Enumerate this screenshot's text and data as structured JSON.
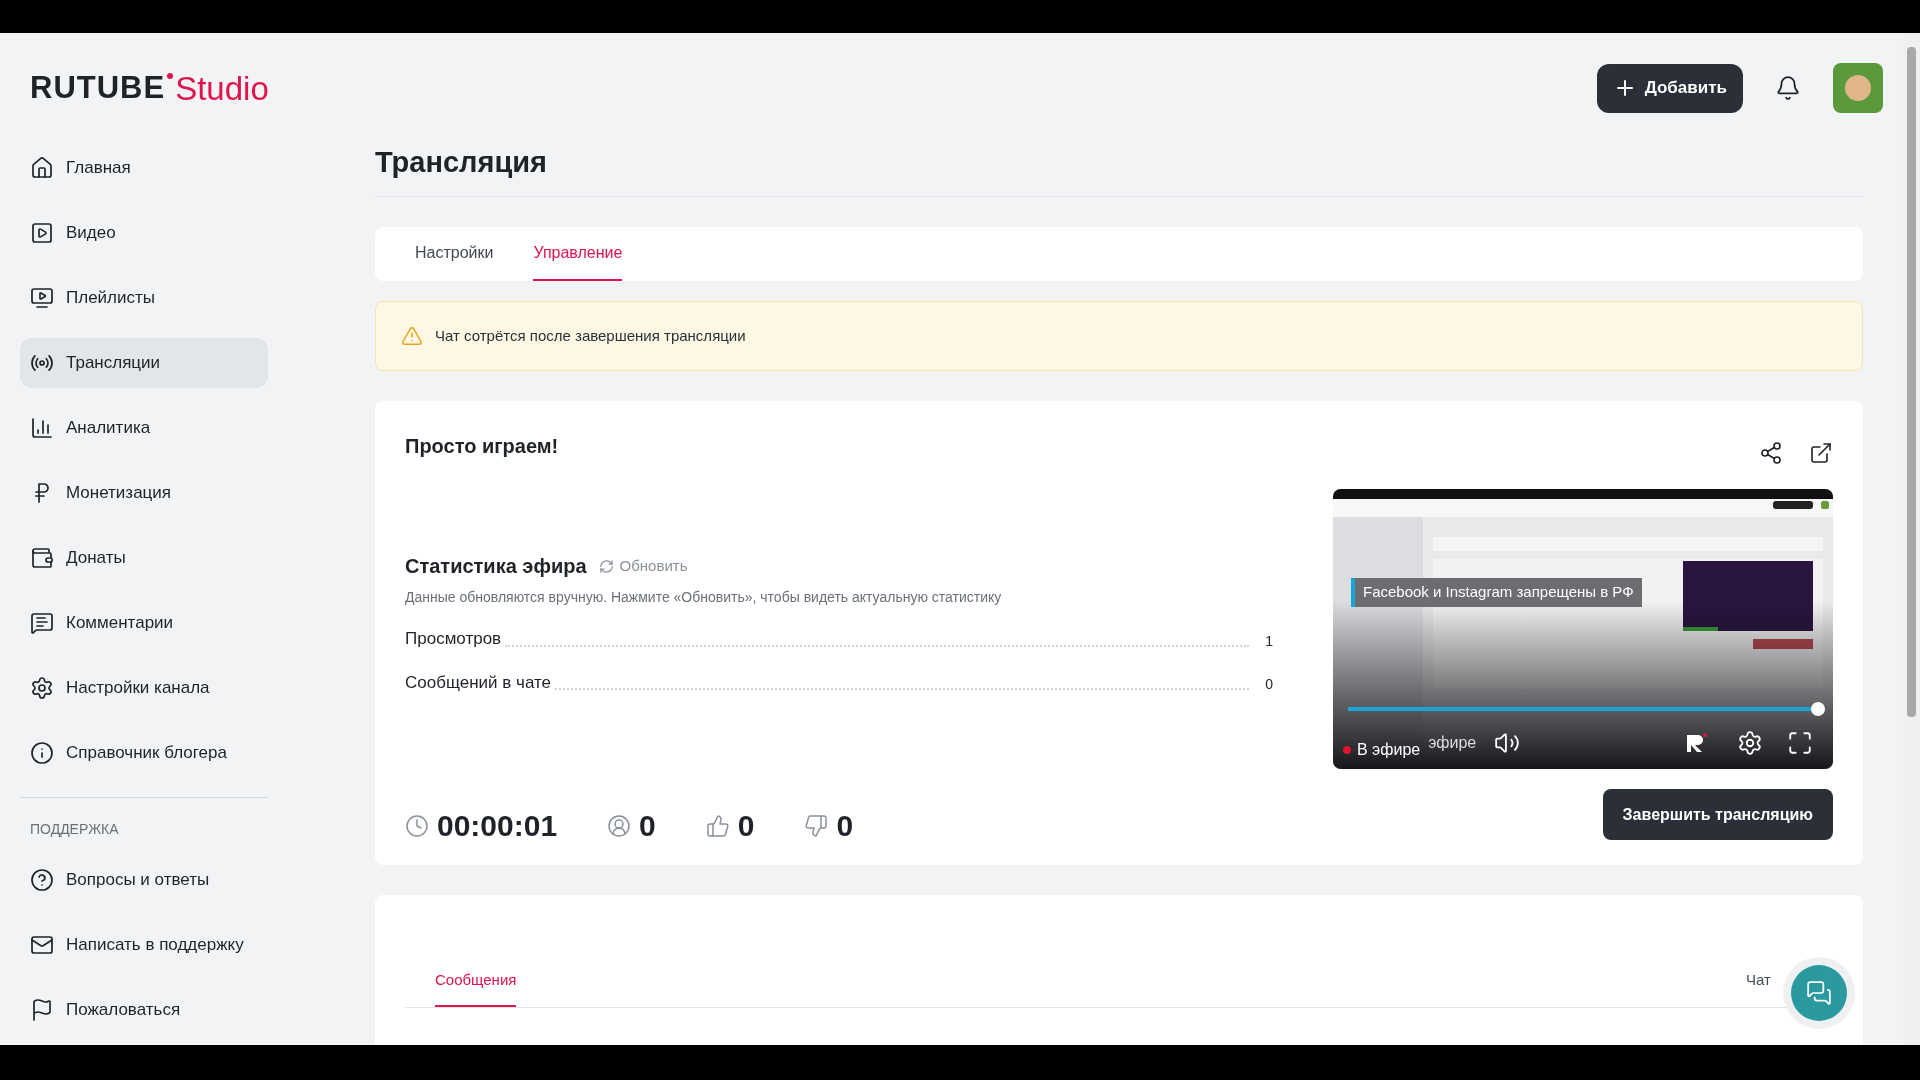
{
  "logo": {
    "brand": "RUTUBE",
    "product": "Studio"
  },
  "header": {
    "add_button": "Добавить"
  },
  "sidebar": {
    "items": [
      {
        "label": "Главная",
        "kind": "home",
        "selected": false
      },
      {
        "label": "Видео",
        "kind": "video",
        "selected": false
      },
      {
        "label": "Плейлисты",
        "kind": "playlist",
        "selected": false
      },
      {
        "label": "Трансляции",
        "kind": "broadcast",
        "selected": true
      },
      {
        "label": "Аналитика",
        "kind": "chart",
        "selected": false
      },
      {
        "label": "Монетизация",
        "kind": "ruble",
        "selected": false
      },
      {
        "label": "Донаты",
        "kind": "wallet",
        "selected": false
      },
      {
        "label": "Комментарии",
        "kind": "comment",
        "selected": false
      },
      {
        "label": "Настройки канала",
        "kind": "gear",
        "selected": false
      },
      {
        "label": "Справочник блогера",
        "kind": "info",
        "selected": false
      }
    ],
    "support_heading": "ПОДДЕРЖКА",
    "support_items": [
      {
        "label": "Вопросы и ответы",
        "kind": "question",
        "selected": false
      },
      {
        "label": "Написать в поддержку",
        "kind": "mail",
        "selected": false
      },
      {
        "label": "Пожаловаться",
        "kind": "flag",
        "selected": false
      }
    ]
  },
  "page_title": "Трансляция",
  "tabs": [
    {
      "label": "Настройки",
      "selected": false
    },
    {
      "label": "Управление",
      "selected": true
    }
  ],
  "warning": "Чат сотрётся после завершения трансляции",
  "stream": {
    "title": "Просто играем!",
    "stats_heading": "Статистика эфира",
    "refresh": "Обновить",
    "stats_note": "Данные обновляются вручную. Нажмите «Обновить», чтобы видеть актуальную статистику",
    "stats": [
      {
        "label": "Просмотров",
        "value": "1"
      },
      {
        "label": "Сообщений в чате",
        "value": "0"
      }
    ],
    "counters": [
      {
        "kind": "time",
        "value": "00:00:01"
      },
      {
        "kind": "viewers",
        "value": "0"
      },
      {
        "kind": "likes",
        "value": "0"
      },
      {
        "kind": "dislikes",
        "value": "0"
      }
    ],
    "player": {
      "notice": "Facebook и Instagram запрещены в РФ",
      "level": 1,
      "live_label": "В эфире",
      "live_label_ghost": "эфире"
    },
    "end_button": "Завершить трансляцию"
  },
  "chat": {
    "tabs": [
      {
        "label": "Сообщения",
        "selected": true
      },
      {
        "label": "Чат",
        "selected": false
      }
    ]
  }
}
